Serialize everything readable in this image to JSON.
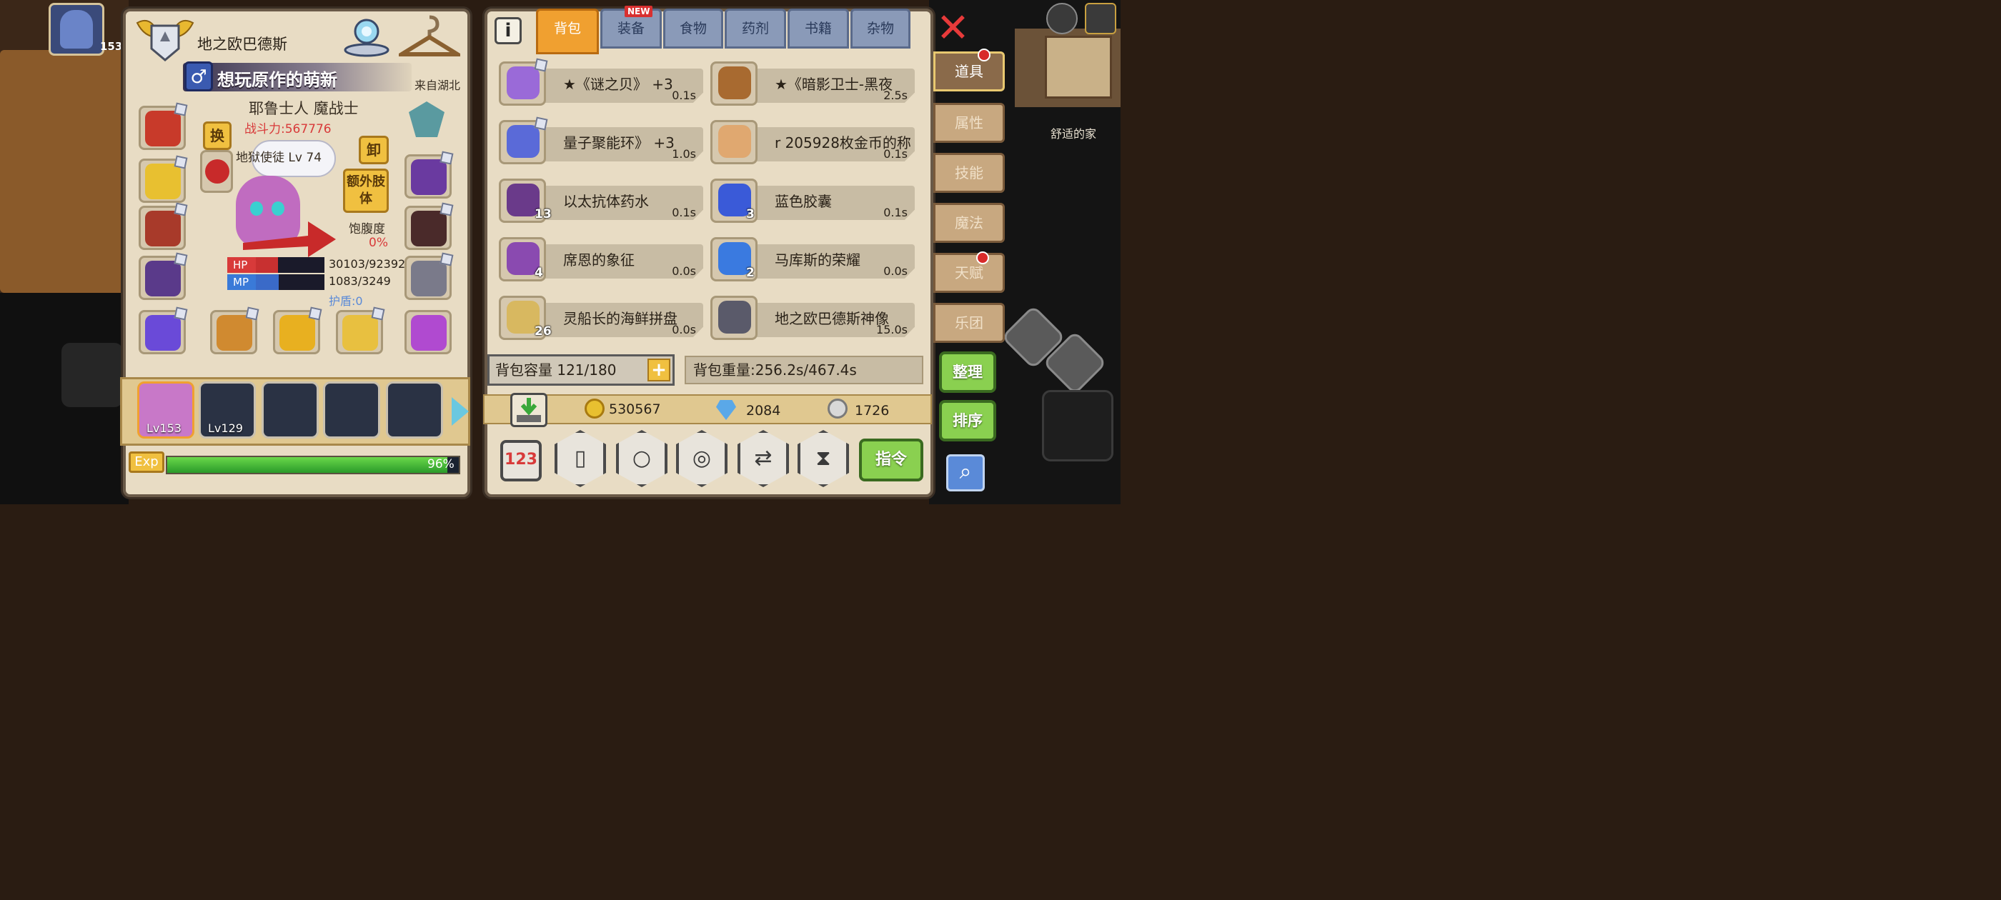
{
  "background": {
    "avatar_level": "153",
    "home_label": "舒适的家"
  },
  "character": {
    "name": "地之欧巴德斯",
    "title": "想玩原作的萌新",
    "origin": "来自湖北",
    "class": "耶鲁士人 魔战士",
    "power": "战斗力:567776",
    "pet": "A阶 地狱使徒 Lv 74",
    "swap_label": "换",
    "unequip_label": "卸",
    "extra_limb_label": "额外肢体",
    "satiety_label": "饱腹度",
    "satiety_value": "0%",
    "hp_label": "HP",
    "mp_label": "MP",
    "hp_text": "30103/92392",
    "mp_text": "1083/3249",
    "hp_fraction": 0.326,
    "mp_fraction": 0.333,
    "shield_text": "护盾:0"
  },
  "team": {
    "members": [
      {
        "level": "Lv153"
      },
      {
        "level": "Lv129"
      },
      {
        "level": ""
      },
      {
        "level": ""
      },
      {
        "level": ""
      }
    ],
    "exp_label": "Exp",
    "exp_percent_text": "96%",
    "exp_fraction": 0.96
  },
  "inventory": {
    "tabs": [
      "背包",
      "装备",
      "食物",
      "药剂",
      "书籍",
      "杂物"
    ],
    "active_tab": "背包",
    "new_badge": "NEW",
    "items": [
      {
        "name": "★《谜之贝》 +3",
        "weight": "0.1s",
        "count": "",
        "icon": "shell-icon",
        "color": "#9a6ad8"
      },
      {
        "name": "★《暗影卫士-黑夜",
        "weight": "2.5s",
        "count": "",
        "icon": "chest-armor-icon",
        "color": "#a86a30"
      },
      {
        "name": "量子聚能环》 +3",
        "weight": "1.0s",
        "count": "",
        "icon": "ring-device-icon",
        "color": "#5a6ad8"
      },
      {
        "name": "r 205928枚金币的称",
        "weight": "0.1s",
        "count": "",
        "icon": "card-icon",
        "color": "#e0a870"
      },
      {
        "name": "以太抗体药水",
        "weight": "0.1s",
        "count": "13",
        "icon": "potion-icon",
        "color": "#6a3a8a"
      },
      {
        "name": "蓝色胶囊",
        "weight": "0.1s",
        "count": "3",
        "icon": "capsule-icon",
        "color": "#3a5ad8"
      },
      {
        "name": "席恩的象征",
        "weight": "0.0s",
        "count": "4",
        "icon": "crystal-icon",
        "color": "#8a4ab0"
      },
      {
        "name": "马库斯的荣耀",
        "weight": "0.0s",
        "count": "2",
        "icon": "emblem-icon",
        "color": "#3a7ae0"
      },
      {
        "name": "灵船长的海鲜拼盘",
        "weight": "0.0s",
        "count": "26",
        "icon": "seafood-platter-icon",
        "color": "#d8b860"
      },
      {
        "name": "地之欧巴德斯神像",
        "weight": "15.0s",
        "count": "",
        "icon": "statue-icon",
        "color": "#5a5a6a"
      }
    ],
    "capacity_text": "背包容量 121/180",
    "weight_text": "背包重量:256.2s/467.4s",
    "gold": "530567",
    "diamonds": "2084",
    "silver": "1726",
    "command_label": "指令",
    "counter_label": "123"
  },
  "side_tabs": [
    {
      "label": "道具",
      "active": true,
      "dot": true
    },
    {
      "label": "属性",
      "active": false,
      "dot": false
    },
    {
      "label": "技能",
      "active": false,
      "dot": false
    },
    {
      "label": "魔法",
      "active": false,
      "dot": false
    },
    {
      "label": "天赋",
      "active": false,
      "dot": true
    },
    {
      "label": "乐团",
      "active": false,
      "dot": false
    }
  ],
  "side_buttons": {
    "arrange": "整理",
    "sort": "排序"
  },
  "colors": {
    "panel": "#e8dcc4",
    "accent_orange": "#f0a030",
    "hp_red": "#d83a3a",
    "mp_blue": "#3a7ad8",
    "button_green": "#8ad050",
    "button_yellow": "#f0c040"
  }
}
